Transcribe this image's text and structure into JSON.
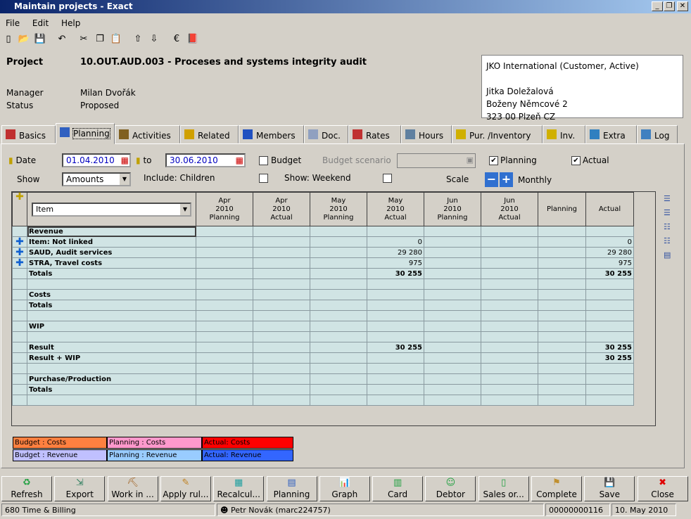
{
  "window": {
    "title": "Maintain projects - Exact"
  },
  "menu": [
    "File",
    "Edit",
    "Help"
  ],
  "toolbar_icons": [
    "new-icon",
    "open-icon",
    "save-icon",
    "undo-icon",
    "cut-icon",
    "copy-icon",
    "paste-icon",
    "up-icon",
    "down-icon",
    "euro-icon",
    "book-icon"
  ],
  "project": {
    "label": "Project",
    "code_title": "10.OUT.AUD.003 - Proceses and systems integrity audit",
    "manager_label": "Manager",
    "manager": "Milan Dvořák",
    "status_label": "Status",
    "status": "Proposed"
  },
  "address": [
    "JKO International (Customer, Active)",
    "",
    "Jitka Doležalová",
    "Boženy Němcové 2",
    "323 00 Plzeň CZ"
  ],
  "tabs": [
    "Basics",
    "Planning",
    "Activities",
    "Related",
    "Members",
    "Doc.",
    "Rates",
    "Hours",
    "Pur. /Inventory",
    "Inv.",
    "Extra",
    "Log"
  ],
  "filters": {
    "date_label": "Date",
    "date_from": "01.04.2010",
    "to_label": "to",
    "date_to": "30.06.2010",
    "budget_label": "Budget",
    "budget_checked": false,
    "budget_scenario_label": "Budget scenario",
    "planning_label": "Planning",
    "planning_checked": true,
    "actual_label": "Actual",
    "actual_checked": true,
    "show_label": "Show",
    "show_value": "Amounts",
    "include_children_label": "Include: Children",
    "show_weekend_label": "Show: Weekend",
    "scale_label": "Scale",
    "scale_value": "Monthly"
  },
  "grid": {
    "item_select": "Item",
    "columns": [
      [
        "Apr",
        "2010",
        "Planning"
      ],
      [
        "Apr",
        "2010",
        "Actual"
      ],
      [
        "May",
        "2010",
        "Planning"
      ],
      [
        "May",
        "2010",
        "Actual"
      ],
      [
        "Jun",
        "2010",
        "Planning"
      ],
      [
        "Jun",
        "2010",
        "Actual"
      ],
      [
        "Planning"
      ],
      [
        "Actual"
      ]
    ],
    "rows": [
      {
        "label": "Revenue",
        "expand": false,
        "values": [
          "",
          "",
          "",
          "",
          "",
          "",
          "",
          ""
        ]
      },
      {
        "label": "Item: Not linked",
        "expand": true,
        "values": [
          "",
          "",
          "",
          "0",
          "",
          "",
          "",
          "0"
        ]
      },
      {
        "label": "SAUD, Audit services",
        "expand": true,
        "values": [
          "",
          "",
          "",
          "29 280",
          "",
          "",
          "",
          "29 280"
        ]
      },
      {
        "label": "STRA, Travel costs",
        "expand": true,
        "values": [
          "",
          "",
          "",
          "975",
          "",
          "",
          "",
          "975"
        ]
      },
      {
        "label": "Totals",
        "expand": false,
        "values": [
          "",
          "",
          "",
          "30 255",
          "",
          "",
          "",
          "30 255"
        ],
        "bold": true
      },
      {
        "label": "",
        "expand": false,
        "values": [
          "",
          "",
          "",
          "",
          "",
          "",
          "",
          ""
        ]
      },
      {
        "label": "Costs",
        "expand": false,
        "values": [
          "",
          "",
          "",
          "",
          "",
          "",
          "",
          ""
        ]
      },
      {
        "label": "Totals",
        "expand": false,
        "values": [
          "",
          "",
          "",
          "",
          "",
          "",
          "",
          ""
        ]
      },
      {
        "label": "",
        "expand": false,
        "values": [
          "",
          "",
          "",
          "",
          "",
          "",
          "",
          ""
        ]
      },
      {
        "label": "WIP",
        "expand": false,
        "values": [
          "",
          "",
          "",
          "",
          "",
          "",
          "",
          ""
        ]
      },
      {
        "label": "",
        "expand": false,
        "values": [
          "",
          "",
          "",
          "",
          "",
          "",
          "",
          ""
        ]
      },
      {
        "label": "Result",
        "expand": false,
        "values": [
          "",
          "",
          "",
          "30 255",
          "",
          "",
          "",
          "30 255"
        ],
        "bold": true
      },
      {
        "label": "Result + WIP",
        "expand": false,
        "values": [
          "",
          "",
          "",
          "",
          "",
          "",
          "",
          "30 255"
        ],
        "bold": true
      },
      {
        "label": "",
        "expand": false,
        "values": [
          "",
          "",
          "",
          "",
          "",
          "",
          "",
          ""
        ]
      },
      {
        "label": "Purchase/Production",
        "expand": false,
        "values": [
          "",
          "",
          "",
          "",
          "",
          "",
          "",
          ""
        ]
      },
      {
        "label": "Totals",
        "expand": false,
        "values": [
          "",
          "",
          "",
          "",
          "",
          "",
          "",
          ""
        ]
      },
      {
        "label": "",
        "expand": false,
        "values": [
          "",
          "",
          "",
          "",
          "",
          "",
          "",
          ""
        ]
      }
    ]
  },
  "legend": [
    {
      "label": "Budget : Costs",
      "color": "#ff8040"
    },
    {
      "label": "Planning : Costs",
      "color": "#ff99cc"
    },
    {
      "label": "Actual: Costs",
      "color": "#ff0000"
    },
    {
      "label": "Budget : Revenue",
      "color": "#c0c0ff"
    },
    {
      "label": "Planning : Revenue",
      "color": "#99ccff"
    },
    {
      "label": "Actual: Revenue",
      "color": "#3366ff"
    }
  ],
  "buttons": [
    "Refresh",
    "Export",
    "Work in ...",
    "Apply rul...",
    "Recalcul...",
    "Planning",
    "Graph",
    "Card",
    "Debtor",
    "Sales or...",
    "Complete",
    "Save",
    "Close"
  ],
  "statusbar": {
    "company": "680 Time & Billing",
    "user": "Petr Novák (marc224757)",
    "number": "00000000116",
    "date": "10. May 2010"
  }
}
